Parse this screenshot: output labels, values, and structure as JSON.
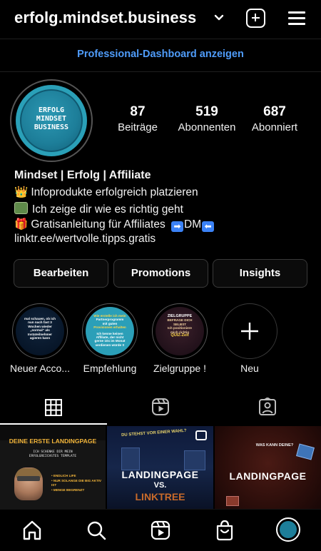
{
  "header": {
    "username": "erfolg.mindset.business",
    "dashboard_link": "Professional-Dashboard anzeigen"
  },
  "profile": {
    "avatar_text": [
      "ERFOLG",
      "MINDSET",
      "BUSINESS"
    ],
    "stats": [
      {
        "value": "87",
        "label": "Beiträge"
      },
      {
        "value": "519",
        "label": "Abonnenten"
      },
      {
        "value": "687",
        "label": "Abonniert"
      }
    ],
    "name": "Mindset | Erfolg | Affiliate",
    "bio_lines": [
      "Infoprodukte erfolgreich platzieren",
      "Ich zeige dir wie es richtig geht",
      "Gratisanleitung für Affiliates",
      "DM"
    ],
    "link": "linktr.ee/wertvolle.tipps.gratis"
  },
  "buttons": {
    "edit": "Bearbeiten",
    "promotions": "Promotions",
    "insights": "Insights"
  },
  "highlights": [
    {
      "label": "Neuer Acco...",
      "text": [
        "mal schauen, ob ich",
        "nun nach fast 3",
        "Wochen wieder",
        "„normal“ als",
        "Instateilnehmer",
        "agieren kann"
      ]
    },
    {
      "label": "Empfehlung",
      "text": [
        "Wie erstelle ich mein",
        "Partnerprogramm",
        "mit guten",
        "Provisionen erhalten",
        "Ich kenne keinen",
        "Affiliate, der nicht",
        "gerne 10x im Monat",
        "verdienen würde !!"
      ]
    },
    {
      "label": "Zielgruppe !",
      "text": [
        "ZIELGRUPPE",
        "BEFRAGE DICH",
        "SELBST",
        "Ich positioniere",
        "mich richtig",
        "QUIZ-Zeit"
      ]
    },
    {
      "label": "Neu",
      "text": []
    }
  ],
  "posts": [
    {
      "title": "DEINE ERSTE LANDINGPAGE",
      "subtitle": "ICH SCHENKE DIR MEIN ERFOLGREICHSTES TEMPLATE",
      "bullets": [
        "• ENDLICH LIFE",
        "• NUR SOLANGE DIE BIG AKTIV IST",
        "• MENGE BEGRENZT"
      ]
    },
    {
      "top_text": "DU STEHST VOR EINER WAHL?",
      "line1": "LANDINGPAGE",
      "line2": "VS.",
      "line3": "LINKTREE"
    },
    {
      "top_text": "WAS KANN DEINE?",
      "main": "LANDINGPAGE"
    }
  ],
  "colors": {
    "accent_link": "#4f9cf9",
    "avatar_bg": "#1d7e99",
    "background": "#000000"
  }
}
